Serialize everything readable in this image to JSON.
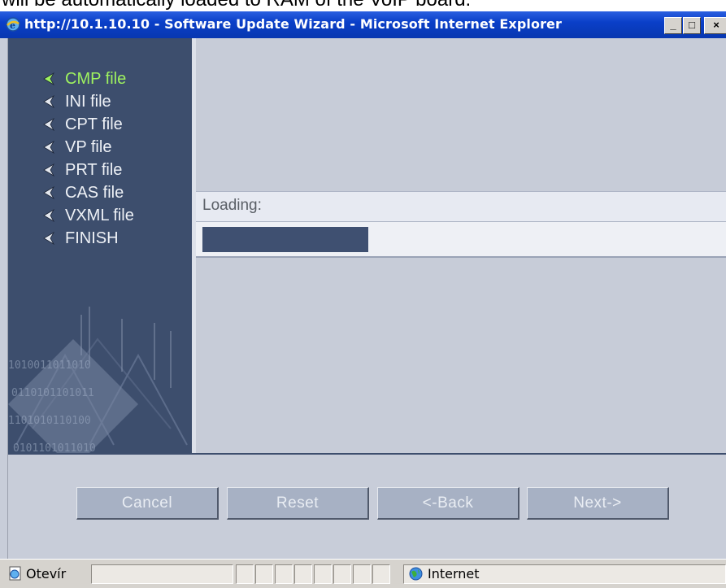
{
  "caption": "will be automatically loaded to RAM of the VoIP board.",
  "window": {
    "title": "http://10.1.10.10 - Software Update Wizard - Microsoft Internet Explorer",
    "controls": {
      "minimize": "_",
      "maximize": "□",
      "close": "×"
    }
  },
  "wizard": {
    "steps": [
      {
        "label": "CMP file",
        "active": true
      },
      {
        "label": "INI file",
        "active": false
      },
      {
        "label": "CPT file",
        "active": false
      },
      {
        "label": "VP file",
        "active": false
      },
      {
        "label": "PRT file",
        "active": false
      },
      {
        "label": "CAS file",
        "active": false
      },
      {
        "label": "VXML file",
        "active": false
      },
      {
        "label": "FINISH",
        "active": false
      }
    ],
    "loading_label": "Loading:",
    "progress_fraction": 0.32,
    "buttons": {
      "cancel": "Cancel",
      "reset": "Reset",
      "back": "<-Back",
      "next": "Next->"
    }
  },
  "status_bar": {
    "text": "Otevír",
    "zone": "Internet"
  },
  "colors": {
    "nav_background": "#3d4e6d",
    "active_step": "#9ff35f",
    "progress_fill": "#3f5071",
    "title_bar": "#0a3fc8"
  },
  "icons": {
    "window": "ie-globe-icon",
    "step": "arrow-bullet-icon",
    "status": "page-icon",
    "zone": "globe-icon"
  }
}
